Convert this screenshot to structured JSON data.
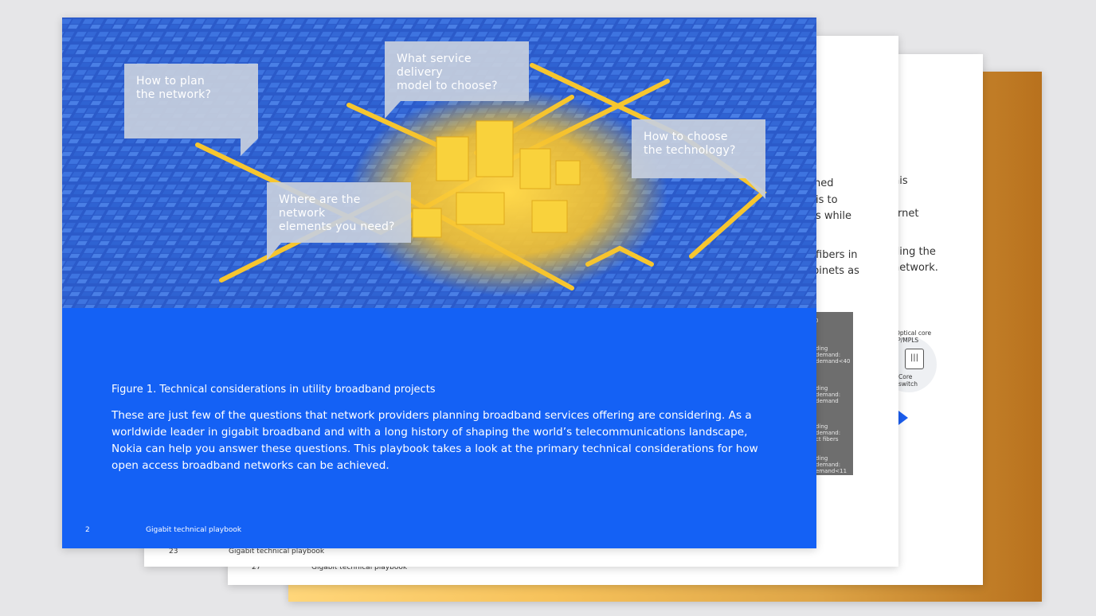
{
  "pages": {
    "page4": {
      "footer_num": "27",
      "footer_title": "Gigabit technical playbook"
    },
    "page3": {
      "footer_num": "23",
      "footer_title": "Gigabit technical playbook",
      "text_fragments": [
        "his",
        "ernet",
        "ding the",
        "network."
      ],
      "diagram": {
        "core_label": "Optical core\nIP/MPLS",
        "switch_label": "Core\nswitch",
        "switch_icon": "|||"
      }
    },
    "page2": {
      "text_fragments": [
        "ned",
        "is to",
        "s while",
        "fibers in",
        "binets as"
      ],
      "grey_panel": [
        "0",
        "ding demand:\n demand<40",
        "ding demand:\n demand",
        "ding demand:\nct fibers",
        "ding demand:\nemand<11"
      ]
    }
  },
  "front": {
    "bubbles": [
      {
        "text": "How to plan\nthe network?"
      },
      {
        "text": "What service delivery\nmodel to choose?"
      },
      {
        "text": "How to choose\nthe technology?"
      },
      {
        "text": "Where are the network\nelements you need?"
      }
    ],
    "figure_caption": "Figure 1. Technical considerations in utility broadband projects",
    "body": "These are just few of the questions that network providers planning broadband services offering are considering. As a worldwide leader in gigabit broadband and with a long history of shaping the world’s telecommunications landscape, Nokia can help you answer these questions. This playbook takes a look at the primary technical considerations for how open access broadband networks can be achieved.",
    "footer_num": "2",
    "footer_title": "Gigabit technical playbook"
  },
  "colors": {
    "hero_blue": "#2a57c4",
    "panel_blue": "#1461f5",
    "gold": "#f5c542",
    "bubble_grey": "#c6cfde"
  }
}
